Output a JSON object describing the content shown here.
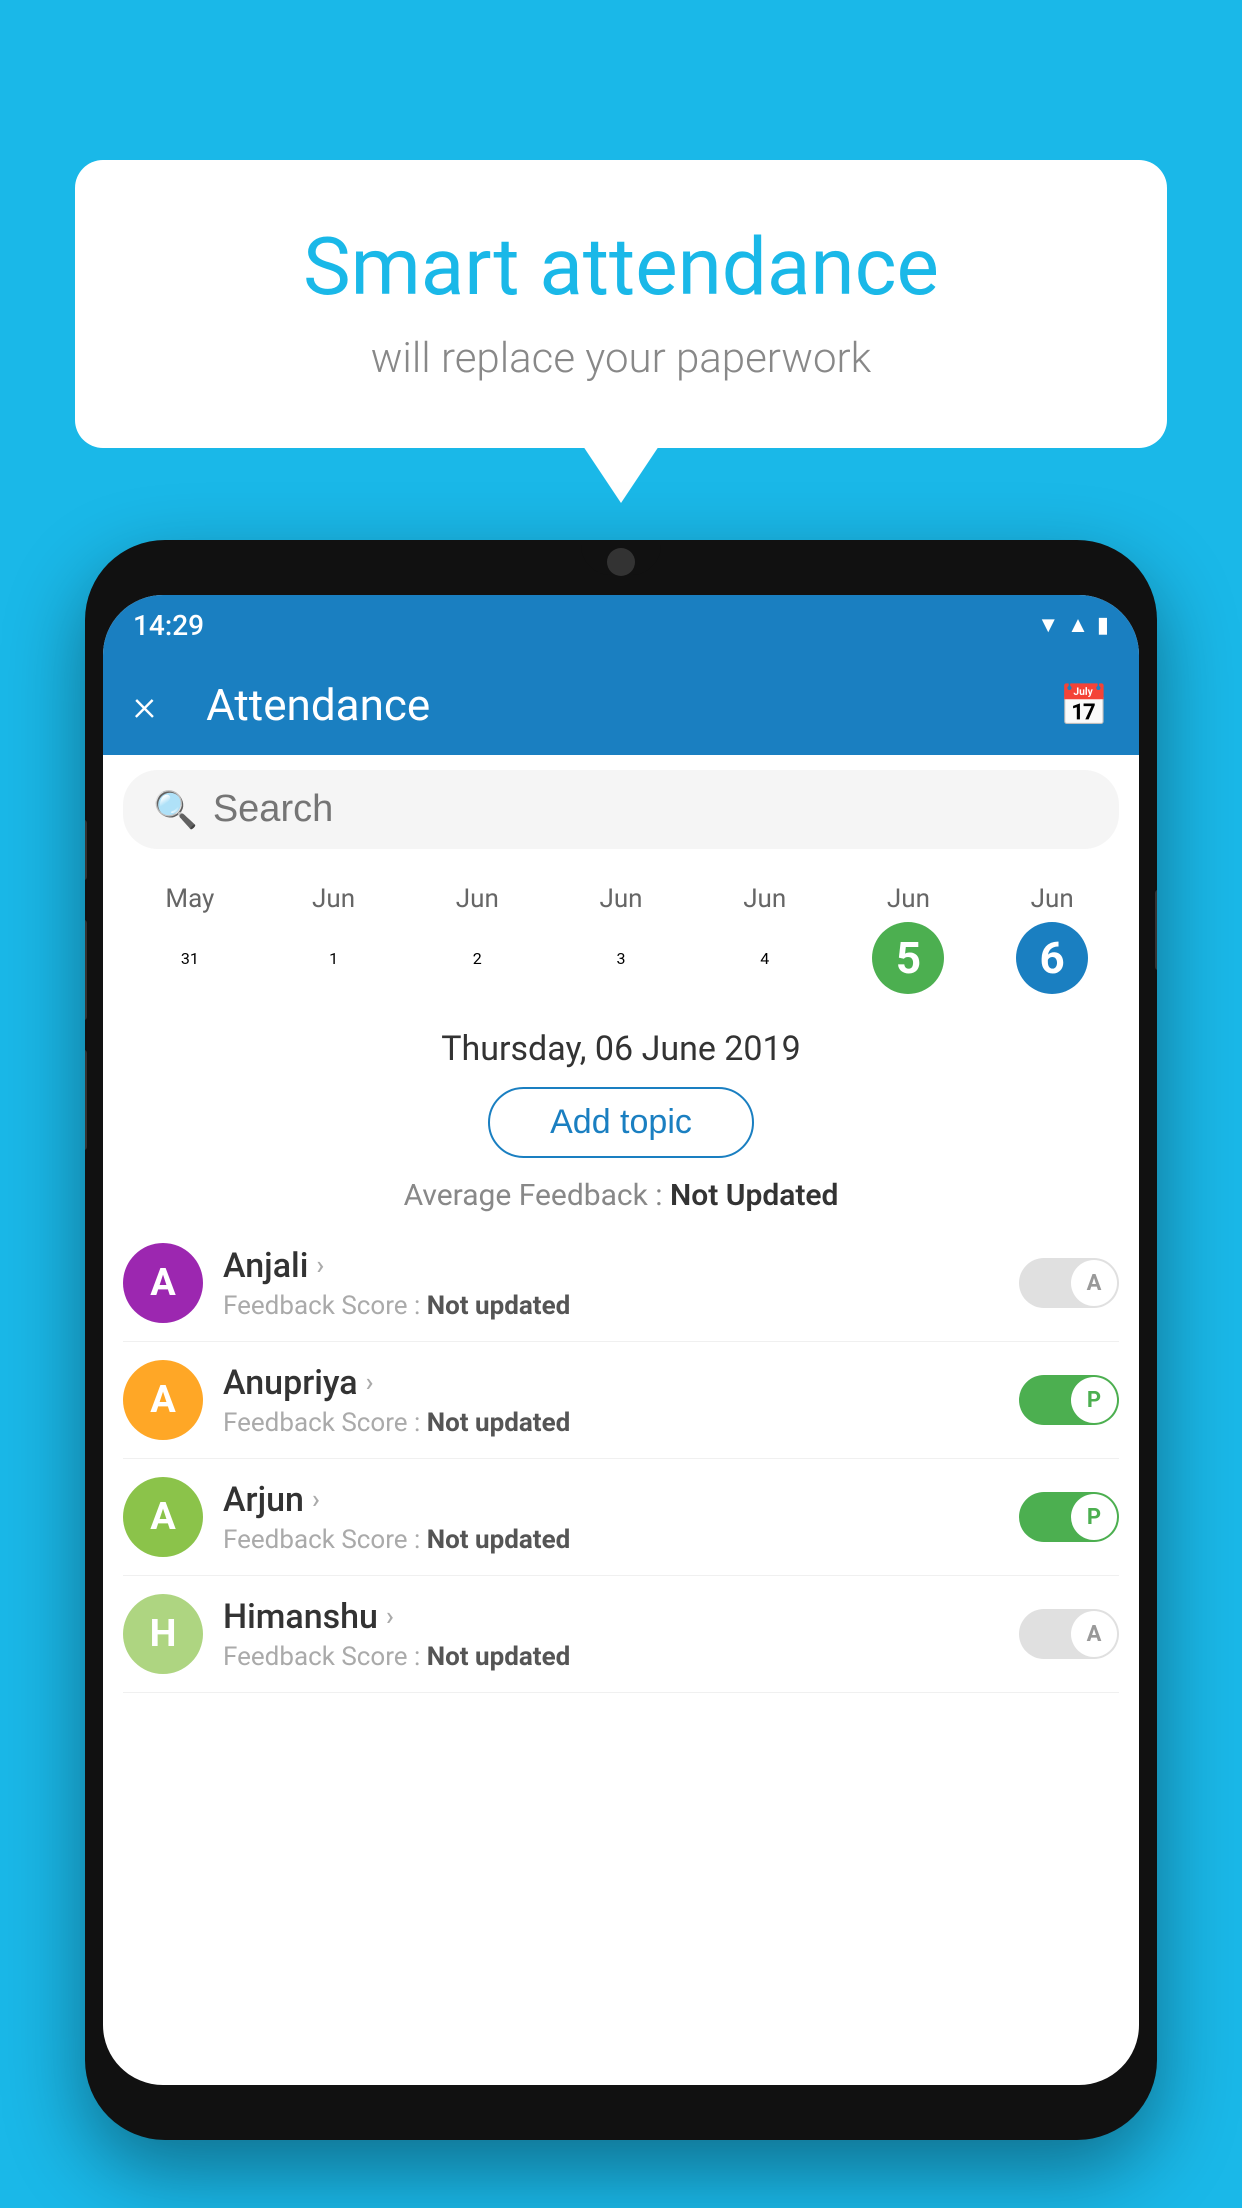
{
  "background_color": "#1ab8e8",
  "bubble": {
    "title": "Smart attendance",
    "subtitle": "will replace your paperwork"
  },
  "app": {
    "status_time": "14:29",
    "title": "Attendance",
    "close_label": "×",
    "search_placeholder": "Search",
    "selected_date_display": "Thursday, 06 June 2019",
    "add_topic_label": "Add topic",
    "avg_feedback_label": "Average Feedback :",
    "avg_feedback_value": "Not Updated"
  },
  "calendar": {
    "dates": [
      {
        "month": "May",
        "day": "31",
        "state": "normal"
      },
      {
        "month": "Jun",
        "day": "1",
        "state": "normal"
      },
      {
        "month": "Jun",
        "day": "2",
        "state": "normal"
      },
      {
        "month": "Jun",
        "day": "3",
        "state": "normal"
      },
      {
        "month": "Jun",
        "day": "4",
        "state": "normal"
      },
      {
        "month": "Jun",
        "day": "5",
        "state": "today"
      },
      {
        "month": "Jun",
        "day": "6",
        "state": "selected"
      }
    ]
  },
  "students": [
    {
      "name": "Anjali",
      "avatar_letter": "A",
      "avatar_color": "#9c27b0",
      "feedback": "Not updated",
      "toggle": "off",
      "toggle_label": "A"
    },
    {
      "name": "Anupriya",
      "avatar_letter": "A",
      "avatar_color": "#ffa726",
      "feedback": "Not updated",
      "toggle": "on",
      "toggle_label": "P"
    },
    {
      "name": "Arjun",
      "avatar_letter": "A",
      "avatar_color": "#8bc34a",
      "feedback": "Not updated",
      "toggle": "on",
      "toggle_label": "P"
    },
    {
      "name": "Himanshu",
      "avatar_letter": "H",
      "avatar_color": "#aed581",
      "feedback": "Not updated",
      "toggle": "off",
      "toggle_label": "A"
    }
  ]
}
